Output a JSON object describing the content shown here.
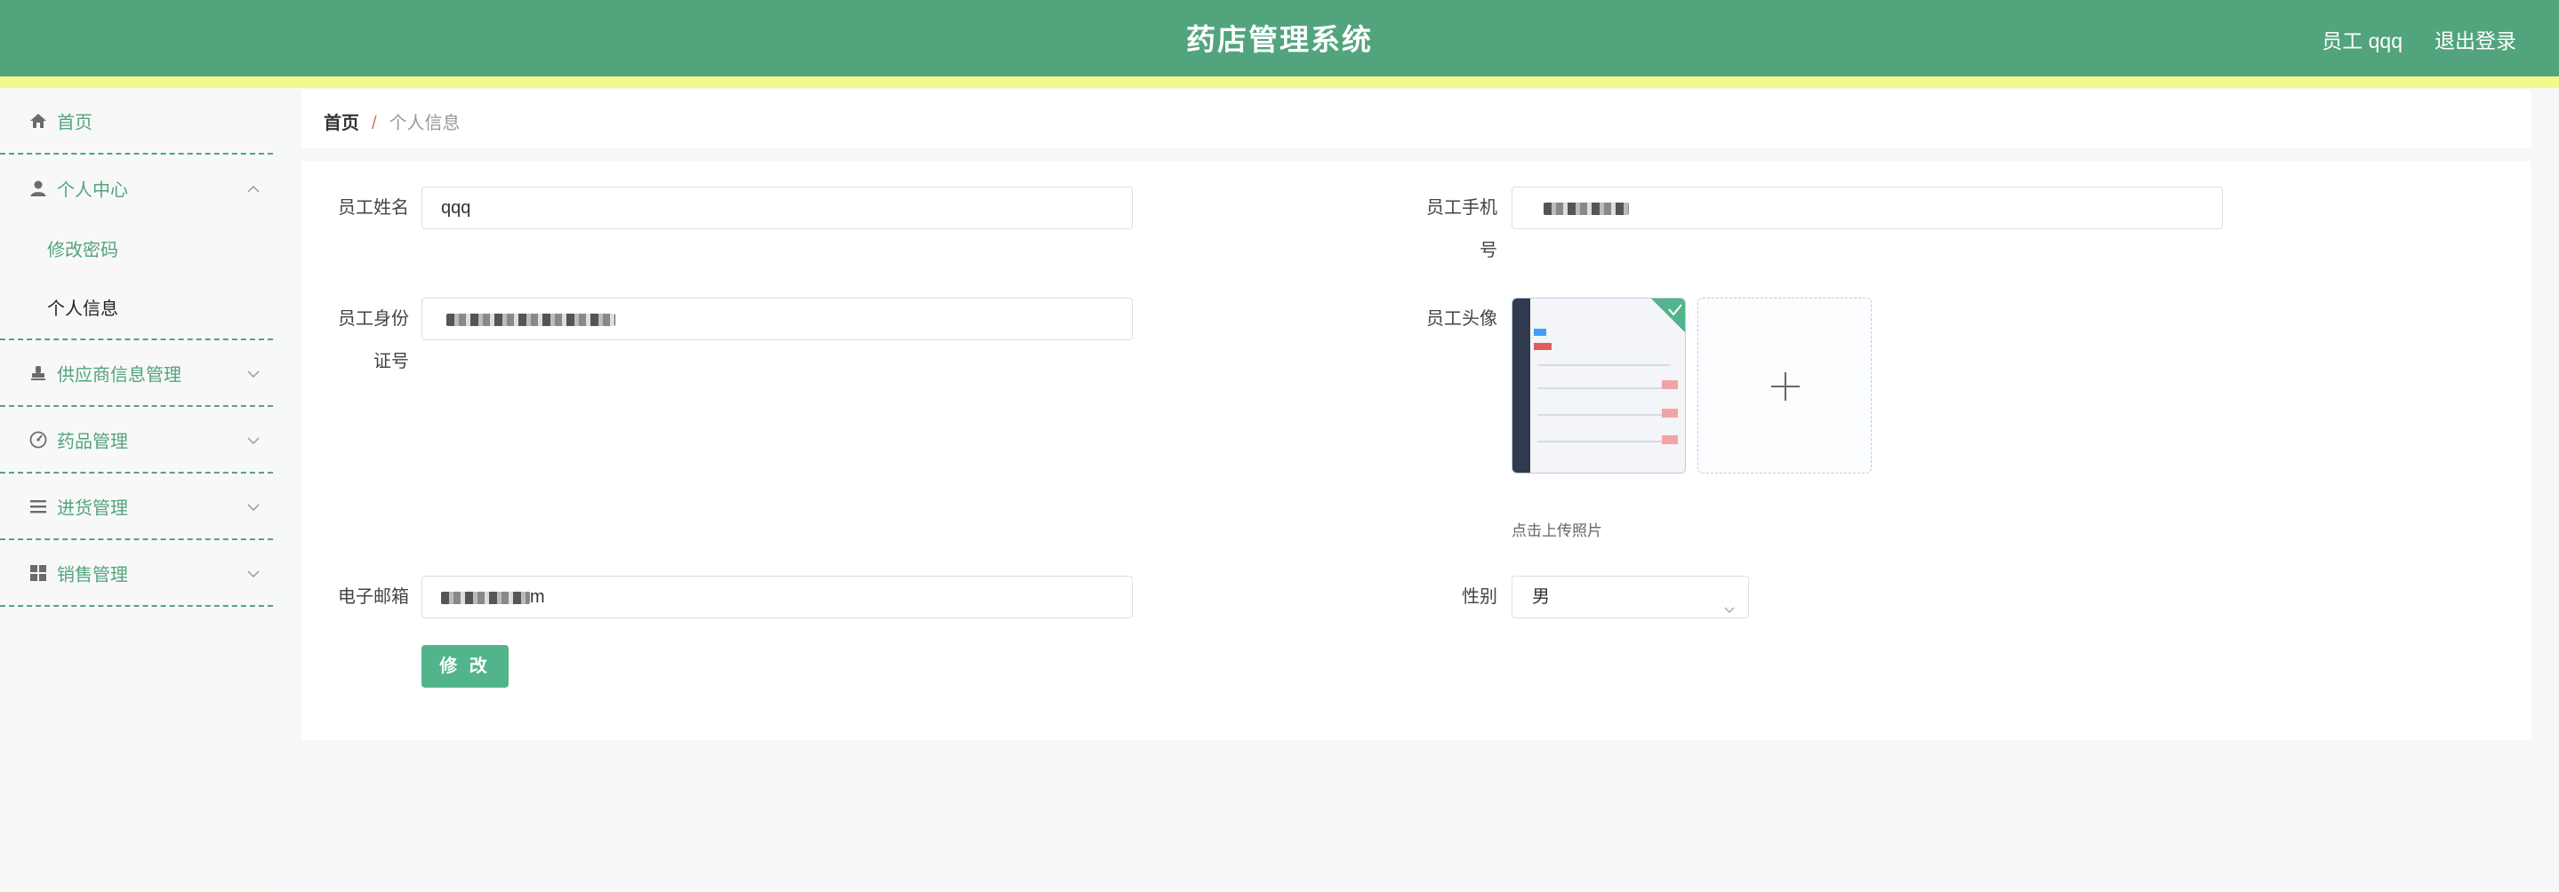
{
  "header": {
    "title": "药店管理系统",
    "user_label": "员工 qqq",
    "logout_label": "退出登录",
    "bg_color": "#52a47d",
    "stripe_color": "#f4f98c"
  },
  "sidebar": {
    "accent_color": "#52a47d",
    "items": [
      {
        "label": "首页",
        "icon": "home-icon"
      },
      {
        "label": "个人中心",
        "icon": "user-icon",
        "expanded": true,
        "children": [
          {
            "label": "修改密码"
          },
          {
            "label": "个人信息",
            "active": true
          }
        ]
      },
      {
        "label": "供应商信息管理",
        "icon": "stamp-icon",
        "expanded": false
      },
      {
        "label": "药品管理",
        "icon": "gauge-icon",
        "expanded": false
      },
      {
        "label": "进货管理",
        "icon": "list-icon",
        "expanded": false
      },
      {
        "label": "销售管理",
        "icon": "grid-icon",
        "expanded": false
      }
    ]
  },
  "breadcrumb": {
    "home": "首页",
    "separator": "/",
    "current": "个人信息"
  },
  "form": {
    "name": {
      "label": "员工姓名",
      "value": "qqq"
    },
    "phone": {
      "label_line1": "员工手机",
      "label_line2": "号"
    },
    "idcard": {
      "label_line1": "员工身份",
      "label_line2": "证号"
    },
    "avatar": {
      "label": "员工头像",
      "upload_tip": "点击上传照片",
      "plus": "+"
    },
    "email": {
      "label": "电子邮箱",
      "value_suffix": "m"
    },
    "gender": {
      "label": "性别",
      "value": "男"
    },
    "submit_label": "修 改",
    "submit_color": "#52b48a"
  }
}
